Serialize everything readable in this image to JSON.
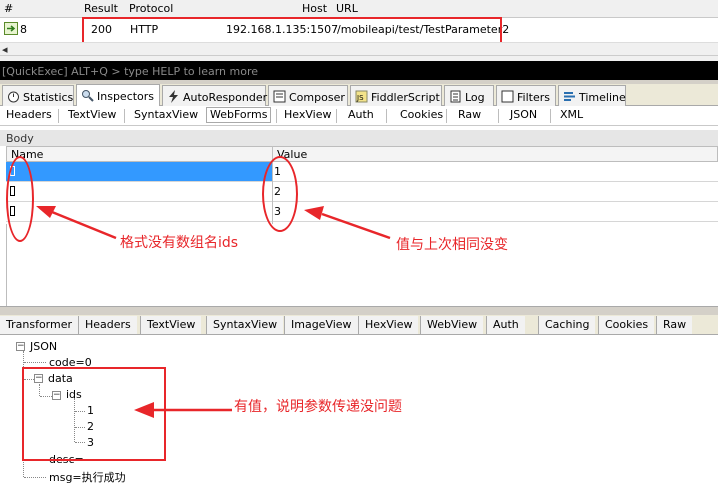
{
  "sessions": {
    "headers": {
      "num": "#",
      "result": "Result",
      "protocol": "Protocol",
      "host": "Host",
      "url": "URL"
    },
    "row": {
      "num": "8",
      "result": "200",
      "protocol": "HTTP",
      "host": "192.168.1.135:1507",
      "url": "/mobileapi/test/TestParameter2"
    }
  },
  "quickexec": "[QuickExec] ALT+Q > type HELP to learn more",
  "main_tabs": [
    "Statistics",
    "Inspectors",
    "AutoResponder",
    "Composer",
    "FiddlerScript",
    "Log",
    "Filters",
    "Timeline"
  ],
  "request_tabs": [
    "Headers",
    "TextView",
    "SyntaxView",
    "WebForms",
    "HexView",
    "Auth",
    "Cookies",
    "Raw",
    "JSON",
    "XML"
  ],
  "active_request_tab": "WebForms",
  "body_label": "Body",
  "grid": {
    "col_name": "Name",
    "col_value": "Value",
    "rows": [
      {
        "value": "1"
      },
      {
        "value": "2"
      },
      {
        "value": "3"
      }
    ]
  },
  "response_tabs": [
    "Transformer",
    "Headers",
    "TextView",
    "SyntaxView",
    "ImageView",
    "HexView",
    "WebView",
    "Auth",
    "Caching",
    "Cookies",
    "Raw"
  ],
  "tree": {
    "root": "JSON",
    "code": "code=0",
    "data": "data",
    "ids": "ids",
    "items": [
      "1",
      "2",
      "3"
    ],
    "desc": "desc=",
    "msg": "msg=执行成功"
  },
  "annotations": {
    "no_name": "格式没有数组名ids",
    "same_value": "值与上次相同没变",
    "has_value": "有值，说明参数传递没问题"
  },
  "colors": {
    "annotation": "#e8262a",
    "selected_row": "#3399ff",
    "quickexec_bg": "#000000"
  }
}
